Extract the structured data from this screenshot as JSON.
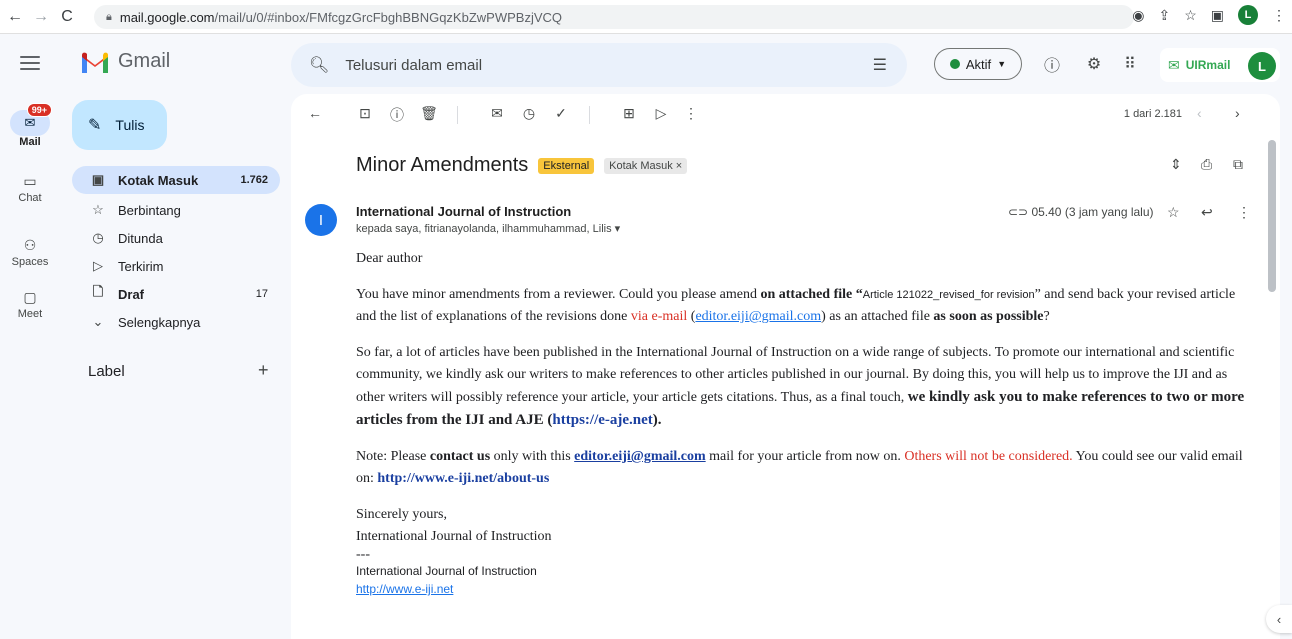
{
  "browser": {
    "url_host": "mail.google.com",
    "url_path": "/mail/u/0/#inbox/FMfcgzGrcFbghBBNGqzKbZwPWPBzjVCQ",
    "profile_initial": "L"
  },
  "header": {
    "app_name": "Gmail",
    "search_placeholder": "Telusuri dalam email",
    "status_label": "Aktif",
    "org_name": "UIRmail",
    "avatar_initial": "L"
  },
  "rail": {
    "mail_label": "Mail",
    "mail_badge": "99+",
    "chat_label": "Chat",
    "spaces_label": "Spaces",
    "meet_label": "Meet"
  },
  "sidebar": {
    "compose_label": "Tulis",
    "items": [
      {
        "label": "Kotak Masuk",
        "count": "1.762"
      },
      {
        "label": "Berbintang",
        "count": ""
      },
      {
        "label": "Ditunda",
        "count": ""
      },
      {
        "label": "Terkirim",
        "count": ""
      },
      {
        "label": "Draf",
        "count": "17"
      },
      {
        "label": "Selengkapnya",
        "count": ""
      }
    ],
    "label_heading": "Label"
  },
  "toolbar": {
    "pager_text": "1 dari 2.181"
  },
  "email": {
    "subject": "Minor Amendments",
    "tag_external": "Eksternal",
    "tag_inbox": "Kotak Masuk ×",
    "sender_initial": "I",
    "sender": "International Journal of Instruction",
    "recipients": "kepada saya, fitrianayolanda, ilhammuhammad, Lilis ▾",
    "time": "05.40 (3 jam yang lalu)",
    "greeting": "Dear author",
    "p1_a": "You have minor amendments from a reviewer. Could you please amend ",
    "p1_b": "on attached file “",
    "p1_c": "Article 121022_revised_for revision",
    "p1_d": "” and send back your revised article and the list of explanations of the revisions done ",
    "p1_e": "via e-mail",
    "p1_f": " (",
    "p1_g": "editor.eiji@gmail.com",
    "p1_h": ") as an attached file ",
    "p1_i": "as soon as possible",
    "p1_j": "?",
    "p2_a": "So far, a lot of articles have been published in the International Journal of Instruction on a wide range of subjects. To promote our international and scientific community, we kindly ask our writers to make references to other articles published in our journal. By doing this, you will help us to improve the IJI and as other writers will possibly reference your article, your article gets citations. Thus, as a final touch, ",
    "p2_b": "we kindly ask you to make references to two or more articles from the IJI and AJE (",
    "p2_c": "https://e-aje.net",
    "p2_d": ").",
    "p3_a": "Note: Please ",
    "p3_b": "contact us",
    "p3_c": " only with this ",
    "p3_d": "editor.eiji@gmail.com",
    "p3_e": " mail for your article from now on. ",
    "p3_f": "Others will not be considered.",
    "p3_g": " You could see our valid email on: ",
    "p3_h": "http://www.e-iji.net/about-us",
    "closing": "Sincerely yours,",
    "sig_name": "International Journal of Instruction",
    "sig_dash": "---",
    "sig_name2": "International Journal of Instruction",
    "sig_url": "http://www.e-iji.net"
  },
  "colors": {
    "accent": "#1a73e8",
    "compose_bg": "#c2e7ff",
    "active_item_bg": "#d3e3fd",
    "warning_red": "#d93025",
    "tag_external": "#f8c53b"
  }
}
